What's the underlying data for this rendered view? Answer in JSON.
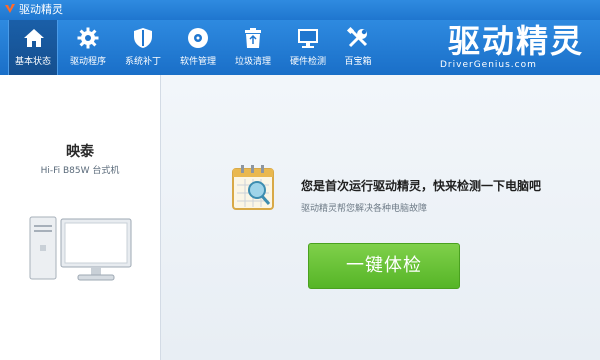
{
  "app": {
    "title": "驱动精灵"
  },
  "toolbar": {
    "items": [
      {
        "label": "基本状态",
        "icon": "home-icon",
        "active": true
      },
      {
        "label": "驱动程序",
        "icon": "gear-icon"
      },
      {
        "label": "系统补丁",
        "icon": "shield-icon"
      },
      {
        "label": "软件管理",
        "icon": "disc-icon"
      },
      {
        "label": "垃圾清理",
        "icon": "trash-icon"
      },
      {
        "label": "硬件检测",
        "icon": "monitor-icon"
      },
      {
        "label": "百宝箱",
        "icon": "tools-icon"
      }
    ]
  },
  "brand": {
    "cn": "驱动精灵",
    "en": "DriverGenius.com"
  },
  "device": {
    "brand": "映泰",
    "model": "Hi-Fi B85W 台式机"
  },
  "main": {
    "headline": "您是首次运行驱动精灵，快来检测一下电脑吧",
    "subtext": "驱动精灵帮您解决各种电脑故障",
    "check_button": "一键体检"
  },
  "colors": {
    "toolbar": "#1f76cf",
    "button": "#5ab82a"
  }
}
